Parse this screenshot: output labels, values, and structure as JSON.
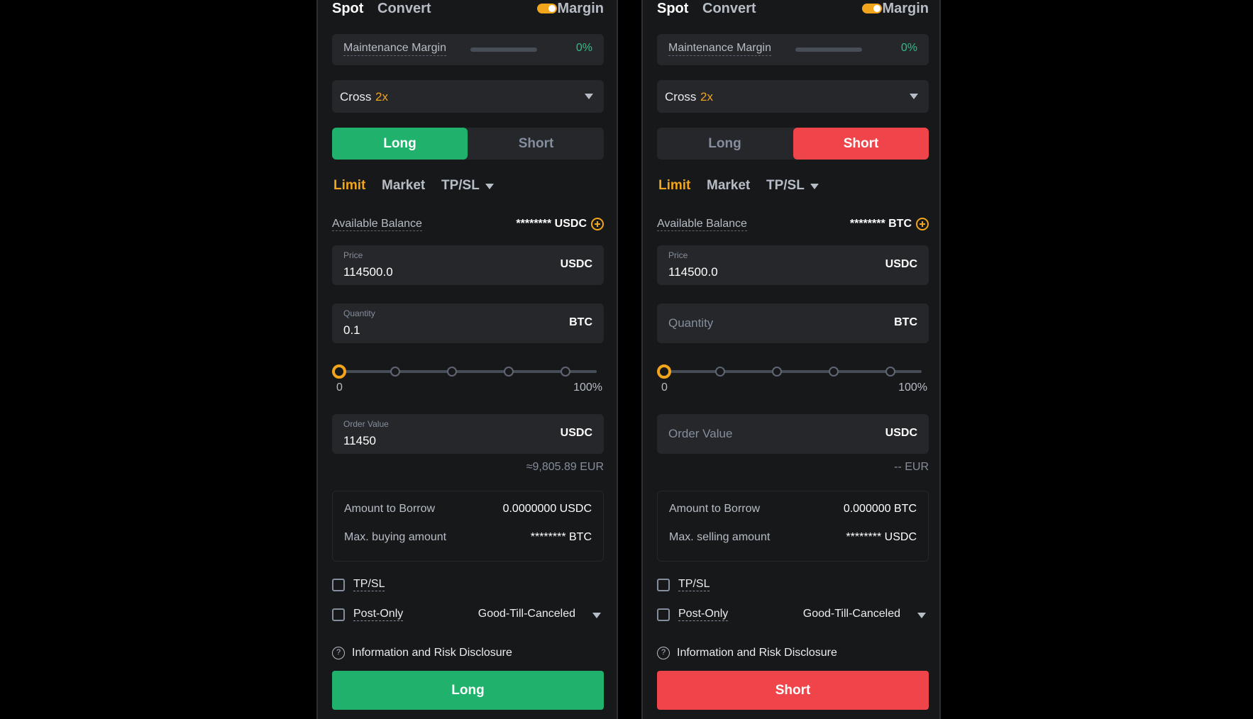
{
  "left": {
    "tabs": {
      "spot": "Spot",
      "convert": "Convert",
      "margin": "Margin"
    },
    "maintenance_margin": {
      "label": "Maintenance Margin",
      "value": "0%",
      "fill_percent": 0
    },
    "leverage": {
      "mode": "Cross",
      "multiplier": "2x"
    },
    "side": {
      "long": "Long",
      "short": "Short",
      "active": "long"
    },
    "order_types": {
      "limit": "Limit",
      "market": "Market",
      "tpsl": "TP/SL"
    },
    "available_balance": {
      "label": "Available Balance",
      "value": "******** USDC"
    },
    "price": {
      "label": "Price",
      "value": "114500.0",
      "unit": "USDC"
    },
    "quantity": {
      "label": "Quantity",
      "value": "0.1",
      "unit": "BTC"
    },
    "slider": {
      "min": "0",
      "max": "100%",
      "value_percent": 0
    },
    "order_value": {
      "label": "Order Value",
      "value": "11450",
      "unit": "USDC"
    },
    "eur_estimate": "≈9,805.89 EUR",
    "amount_to_borrow": {
      "label": "Amount to Borrow",
      "value": "0.0000000 USDC"
    },
    "max_amount": {
      "label": "Max. buying amount",
      "value": "******** BTC"
    },
    "tpsl_checkbox": "TP/SL",
    "post_only_checkbox": "Post-Only",
    "time_in_force": "Good-Till-Canceled",
    "disclosure": "Information and Risk Disclosure",
    "submit": "Long"
  },
  "right": {
    "tabs": {
      "spot": "Spot",
      "convert": "Convert",
      "margin": "Margin"
    },
    "maintenance_margin": {
      "label": "Maintenance Margin",
      "value": "0%",
      "fill_percent": 0
    },
    "leverage": {
      "mode": "Cross",
      "multiplier": "2x"
    },
    "side": {
      "long": "Long",
      "short": "Short",
      "active": "short"
    },
    "order_types": {
      "limit": "Limit",
      "market": "Market",
      "tpsl": "TP/SL"
    },
    "available_balance": {
      "label": "Available Balance",
      "value": "******** BTC"
    },
    "price": {
      "label": "Price",
      "value": "114500.0",
      "unit": "USDC"
    },
    "quantity": {
      "placeholder": "Quantity",
      "unit": "BTC"
    },
    "slider": {
      "min": "0",
      "max": "100%",
      "value_percent": 0
    },
    "order_value": {
      "placeholder": "Order Value",
      "unit": "USDC"
    },
    "eur_estimate": "-- EUR",
    "amount_to_borrow": {
      "label": "Amount to Borrow",
      "value": "0.000000 BTC"
    },
    "max_amount": {
      "label": "Max. selling amount",
      "value": "******** USDC"
    },
    "tpsl_checkbox": "TP/SL",
    "post_only_checkbox": "Post-Only",
    "time_in_force": "Good-Till-Canceled",
    "disclosure": "Information and Risk Disclosure",
    "submit": "Short"
  },
  "colors": {
    "accent": "#f0a51c",
    "buy": "#20b26c",
    "sell": "#ef454a",
    "panel_bg": "#17181a",
    "field_bg": "#26272b"
  },
  "icons": {
    "balance_add": "plus-circle-icon",
    "disclosure": "question-circle-icon",
    "dropdown": "caret-down-icon",
    "margin_toggle": "toggle-switch-icon"
  }
}
